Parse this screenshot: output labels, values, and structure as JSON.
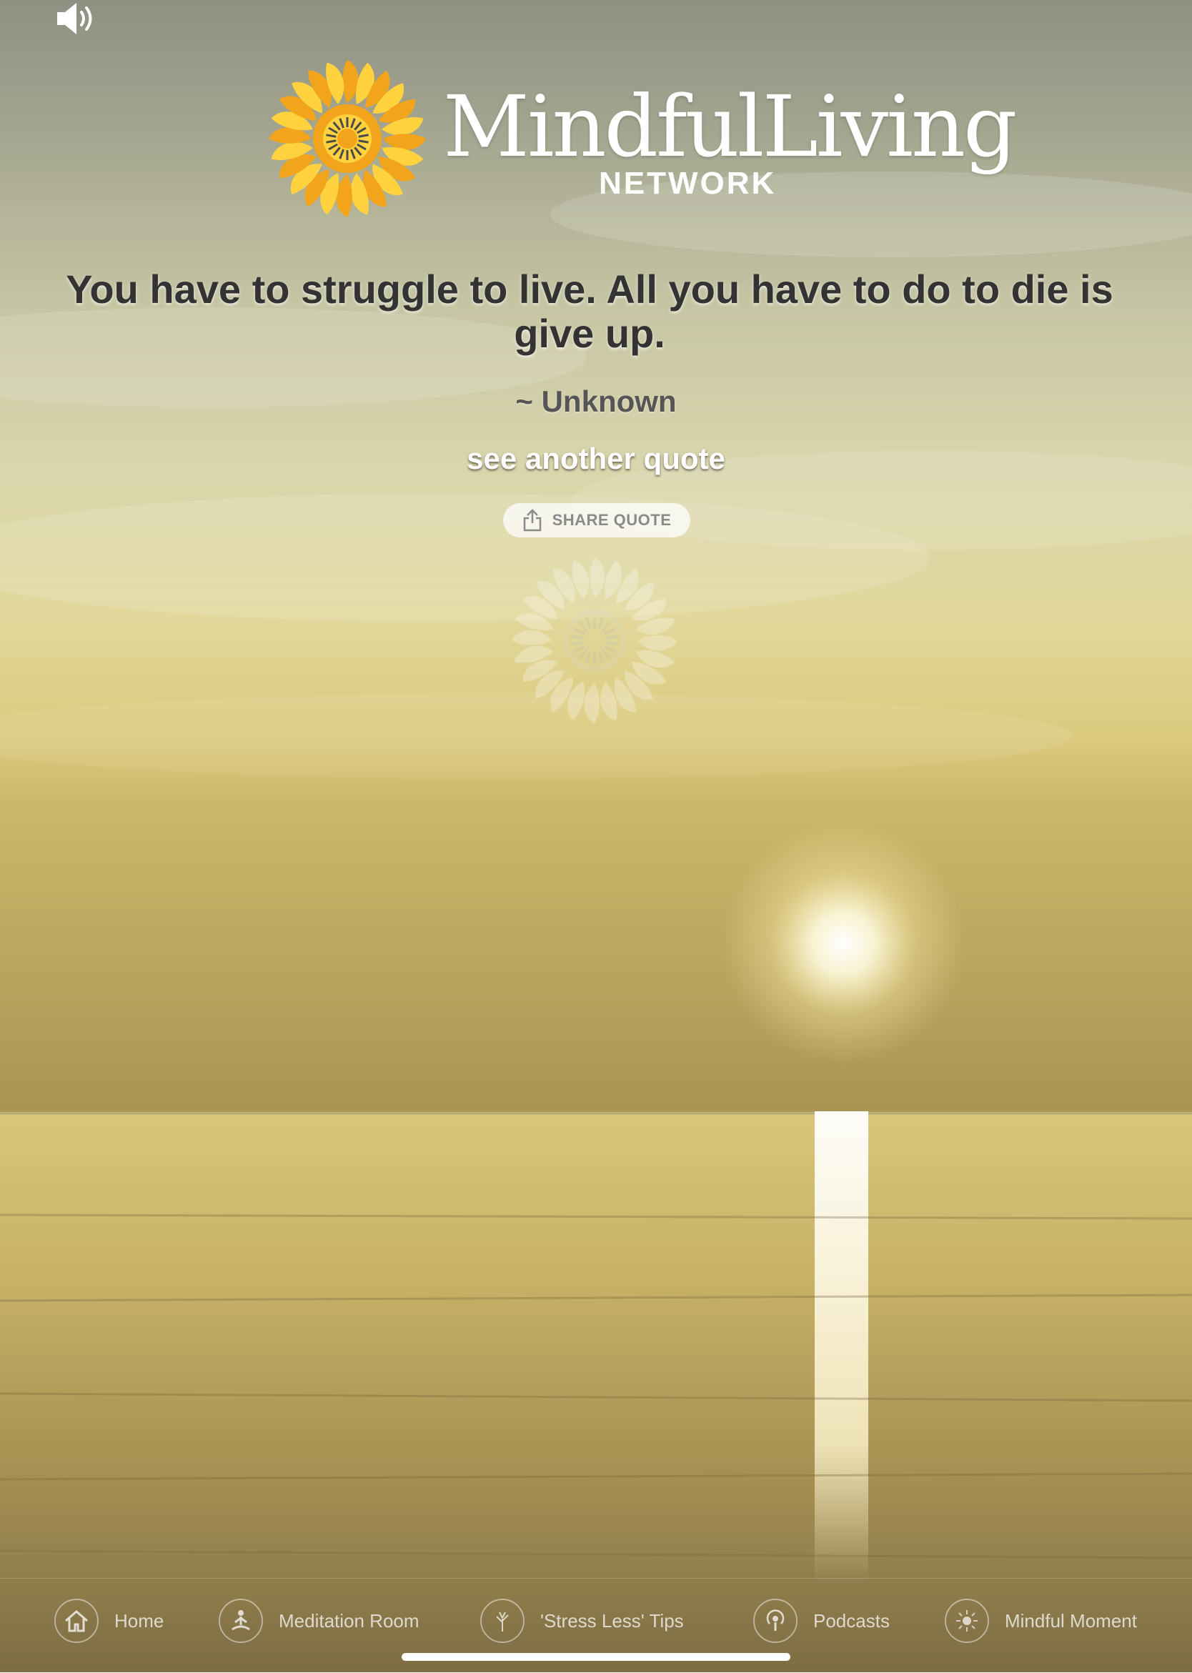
{
  "logo": {
    "word": "MindfulLiving",
    "subword": "NETWORK"
  },
  "quote": {
    "text": "You have to struggle to live. All you have  to do to die is give up.",
    "author": "~ Unknown"
  },
  "actions": {
    "another_label": "see another quote",
    "share_label": "SHARE QUOTE"
  },
  "tabs": [
    {
      "label": "Home",
      "icon": "home-icon"
    },
    {
      "label": "Meditation Room",
      "icon": "meditation-icon"
    },
    {
      "label": "'Stress Less' Tips",
      "icon": "tree-icon"
    },
    {
      "label": "Podcasts",
      "icon": "podcast-icon"
    },
    {
      "label": "Mindful Moment",
      "icon": "sun-icon"
    }
  ],
  "colors": {
    "sun_orange": "#F2A41A",
    "sun_yellow": "#FFD23E",
    "quote_text": "#333333"
  }
}
